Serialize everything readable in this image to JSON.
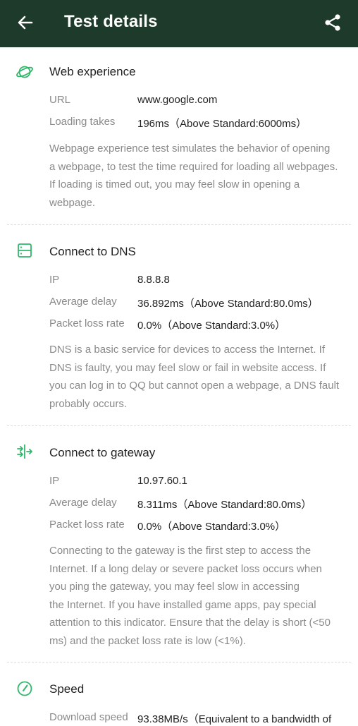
{
  "header": {
    "title": "Test details"
  },
  "colors": {
    "appbar": "#1e3a2a",
    "accent": "#2fb86a"
  },
  "icons": {
    "back": "arrow-left-icon",
    "share": "share-icon",
    "web": "planet-icon",
    "dns": "server-icon",
    "gateway": "gateway-arrows-icon",
    "speed": "speedometer-icon"
  },
  "web": {
    "title": "Web experience",
    "rows": [
      {
        "label": "URL",
        "value": "www.google.com"
      },
      {
        "label": "Loading takes",
        "value": "196ms（Above Standard:6000ms）"
      }
    ],
    "desc": [
      "Webpage experience test simulates the behavior of opening",
      "a webpage, to test the time required for loading all webpages.",
      "If loading is timed out, you may feel slow in opening a",
      "webpage."
    ]
  },
  "dns": {
    "title": "Connect to DNS",
    "rows": [
      {
        "label": "IP",
        "value": "8.8.8.8"
      },
      {
        "label": "Average delay",
        "value": "36.892ms（Above Standard:80.0ms）"
      },
      {
        "label": "Packet loss rate",
        "value": "0.0%（Above Standard:3.0%）"
      }
    ],
    "desc": [
      "DNS is a basic service for devices to access the Internet. If",
      "DNS is faulty, you may feel slow or fail in website access. If",
      "you can log in to QQ but cannot open a webpage, a DNS fault",
      "probably occurs."
    ]
  },
  "gateway": {
    "title": "Connect to gateway",
    "rows": [
      {
        "label": "IP",
        "value": "10.97.60.1"
      },
      {
        "label": "Average delay",
        "value": "8.311ms（Above Standard:80.0ms）"
      },
      {
        "label": "Packet loss rate",
        "value": "0.0%（Above Standard:3.0%）"
      }
    ],
    "desc": [
      "Connecting to the gateway is the first step to access the",
      "Internet. If a long delay or severe packet loss occurs when",
      "you ping the gateway, you may feel slow in accessing",
      "the Internet. If you have installed game apps, pay special",
      "attention to this indicator. Ensure that the delay is short (<50",
      "ms) and the packet loss rate is low (<1%)."
    ]
  },
  "speed": {
    "title": "Speed",
    "rows": [
      {
        "label": "Download speed",
        "value": "93.38MB/s（Equivalent to a bandwidth of"
      }
    ]
  }
}
